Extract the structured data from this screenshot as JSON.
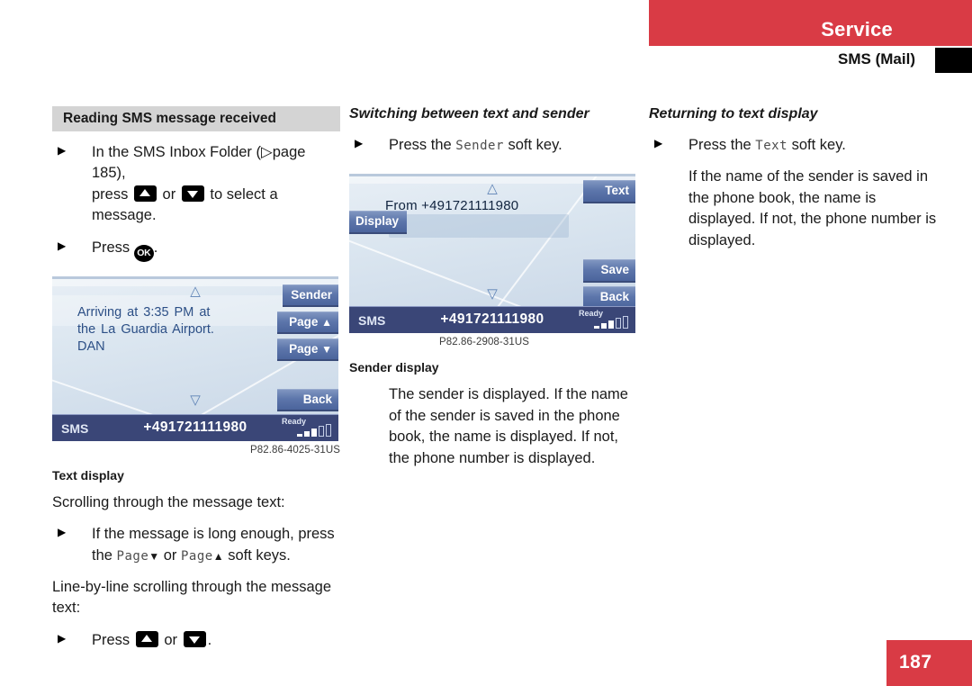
{
  "header": {
    "section": "Service",
    "subsection": "SMS (Mail)",
    "band_color": "#d93b45",
    "tab_color": "#000000"
  },
  "footer": {
    "page_number": "187",
    "block_color": "#d93b45"
  },
  "column1": {
    "heading": "Reading SMS message received",
    "bullet1_part1": "In the SMS Inbox Folder (",
    "bullet1_pageref": "page 185),",
    "bullet1_part2": "press",
    "bullet1_or": "or",
    "bullet1_part3": "to select a message.",
    "bullet2_press": "Press",
    "bullet2_period": ".",
    "ok_key_label": "OK",
    "display": {
      "message_line1": "Arriving at 3:35 PM at",
      "message_line2": "the La Guardia Airport.",
      "message_line3": "DAN",
      "softkey_sender": "Sender",
      "softkey_page_up": "Page",
      "softkey_page_down": "Page",
      "softkey_back": "Back",
      "status_label": "SMS",
      "status_number": "+491721111980",
      "status_ready": "Ready"
    },
    "caption": "P82.86-4025-31US",
    "subheading": "Text display",
    "para_scrolling": "Scrolling through the message text:",
    "bullet3_part1": "If the message is long enough, press",
    "bullet3_the": "the",
    "bullet3_page_a": "Page",
    "bullet3_or": "or",
    "bullet3_page_b": "Page",
    "bullet3_part2": "soft keys.",
    "para_line_scroll": "Line-by-line scrolling through the message text:",
    "bullet4_press": "Press",
    "bullet4_or": "or",
    "bullet4_period": "."
  },
  "column2": {
    "heading": "Switching between text and sender",
    "bullet1_part1": "Press the",
    "bullet1_key": "Sender",
    "bullet1_part2": "soft key.",
    "display": {
      "from_label": "From",
      "from_number": "+491721111980",
      "softkey_display": "Display",
      "softkey_text": "Text",
      "softkey_save": "Save",
      "softkey_back": "Back",
      "status_label": "SMS",
      "status_number": "+491721111980",
      "status_ready": "Ready"
    },
    "caption": "P82.86-2908-31US",
    "subheading": "Sender display",
    "para": "The sender is displayed. If the name of the sender is saved in the phone book, the name is displayed. If not, the phone number is displayed."
  },
  "column3": {
    "heading": "Returning to text display",
    "bullet1_part1": "Press the",
    "bullet1_key": "Text",
    "bullet1_part2": "soft key.",
    "para": "If the name of the sender is saved in the phone book, the name is displayed. If not, the phone number is displayed."
  }
}
